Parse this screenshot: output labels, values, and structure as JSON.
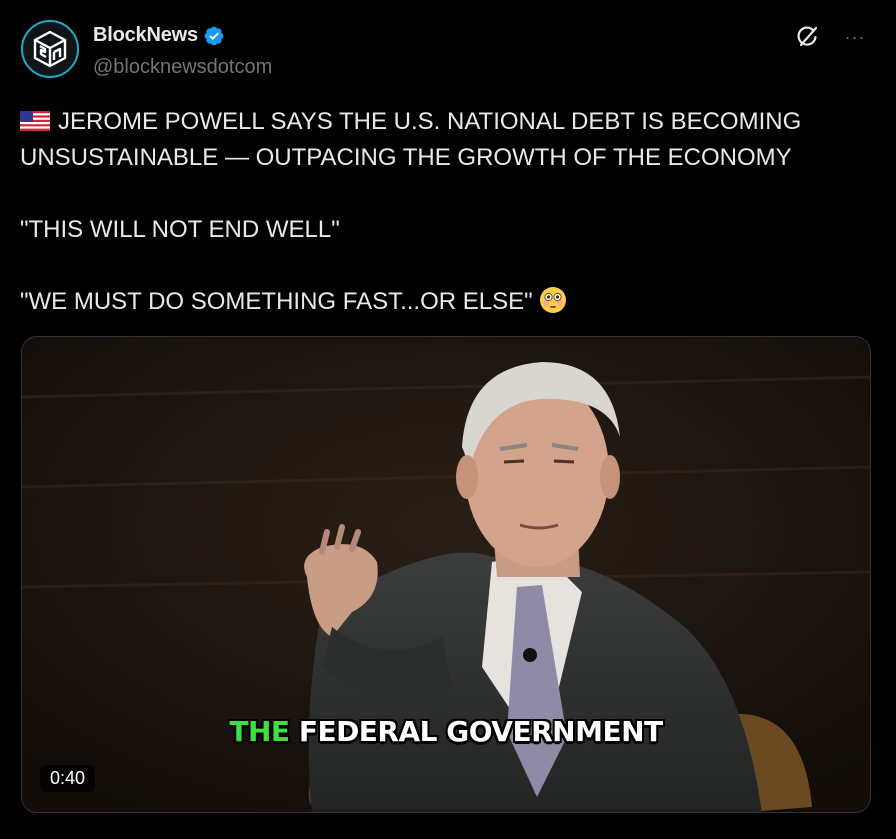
{
  "author": {
    "display_name": "BlockNews",
    "handle": "@blocknewsdotcom",
    "avatar_icon": "blocknews-logo",
    "verified_icon": "verified-badge-icon",
    "accent": "#1d9bf0",
    "avatar_ring": "#20a9c4"
  },
  "actions": {
    "grok_icon": "grok-icon",
    "more_icon": "more-icon",
    "more_label": "···"
  },
  "post": {
    "flag_icon": "us-flag-icon",
    "line1": "JEROME POWELL SAYS THE U.S. NATIONAL DEBT IS BECOMING UNSUSTAINABLE — OUTPACING THE GROWTH OF THE ECONOMY",
    "line2": "\"THIS WILL NOT END WELL\"",
    "line3": "\"WE MUST DO SOMETHING FAST...OR ELSE\"",
    "emoji_icon": "flushed-face-emoji"
  },
  "video": {
    "caption_highlight": "THE",
    "caption_rest": "FEDERAL GOVERNMENT",
    "caption_highlight_color": "#3ee040",
    "duration": "0:40"
  }
}
